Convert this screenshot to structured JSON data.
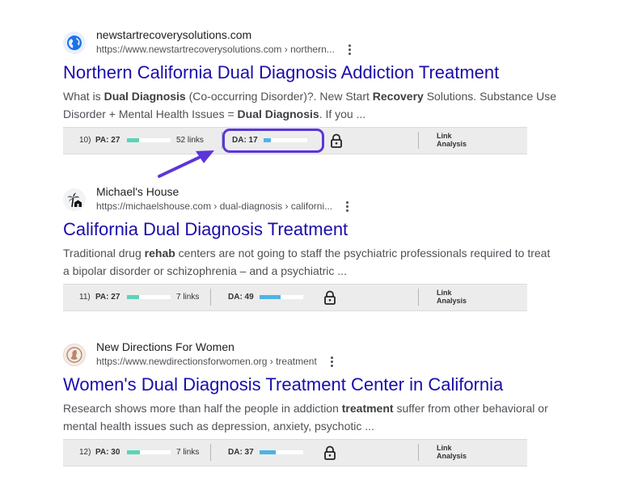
{
  "results": [
    {
      "site_name": "newstartrecoverysolutions.com",
      "url": "https://www.newstartrecoverysolutions.com › northern...",
      "title": "Northern California Dual Diagnosis Addiction Treatment",
      "snippet_line1": [
        "What is ",
        "Dual Diagnosis",
        " (Co-occurring Disorder)?. New Start ",
        "Recovery",
        " Solutions. Substance Use"
      ],
      "snippet_line2": [
        "Disorder + Mental Health Issues = ",
        "Dual Diagnosis",
        ". If you ..."
      ],
      "moz": {
        "rank": "10)",
        "pa": "PA: 27",
        "pa_value": 27,
        "links": "52 links",
        "da": "DA: 17",
        "da_value": 17,
        "link_analysis": [
          "Link",
          "Analysis"
        ]
      }
    },
    {
      "site_name": "Michael's House",
      "url": "https://michaelshouse.com › dual-diagnosis › californi...",
      "title": "California Dual Diagnosis Treatment",
      "snippet_line1": [
        "Traditional drug ",
        "rehab",
        " centers are not going to staff the psychiatric professionals required to treat"
      ],
      "snippet_line2": [
        "a bipolar disorder or schizophrenia – and a psychiatric ..."
      ],
      "moz": {
        "rank": "11)",
        "pa": "PA: 27",
        "pa_value": 27,
        "links": "7 links",
        "da": "DA: 49",
        "da_value": 49,
        "link_analysis": [
          "Link",
          "Analysis"
        ]
      }
    },
    {
      "site_name": "New Directions For Women",
      "url": "https://www.newdirectionsforwomen.org › treatment",
      "title": "Women's Dual Diagnosis Treatment Center in California",
      "snippet_line1": [
        "Research shows more than half the people in addiction ",
        "treatment",
        " suffer from other behavioral or"
      ],
      "snippet_line2": [
        "mental health issues such as depression, anxiety, psychotic ..."
      ],
      "moz": {
        "rank": "12)",
        "pa": "PA: 30",
        "pa_value": 30,
        "links": "7 links",
        "da": "DA: 37",
        "da_value": 37,
        "link_analysis": [
          "Link",
          "Analysis"
        ]
      }
    }
  ],
  "icons": {
    "result_1_favicon": "globe-icon",
    "result_2_favicon": "palm-tree-house-icon",
    "result_3_favicon": "woman-silhouette-icon",
    "menu": "more-vert-icon",
    "lock": "lock-icon",
    "annotation": "arrow-icon"
  },
  "colors": {
    "title_link": "#1a0dab",
    "pa_bar": "#58d5b9",
    "da_bar": "#4eb3e6",
    "highlight": "#5c35d9"
  }
}
